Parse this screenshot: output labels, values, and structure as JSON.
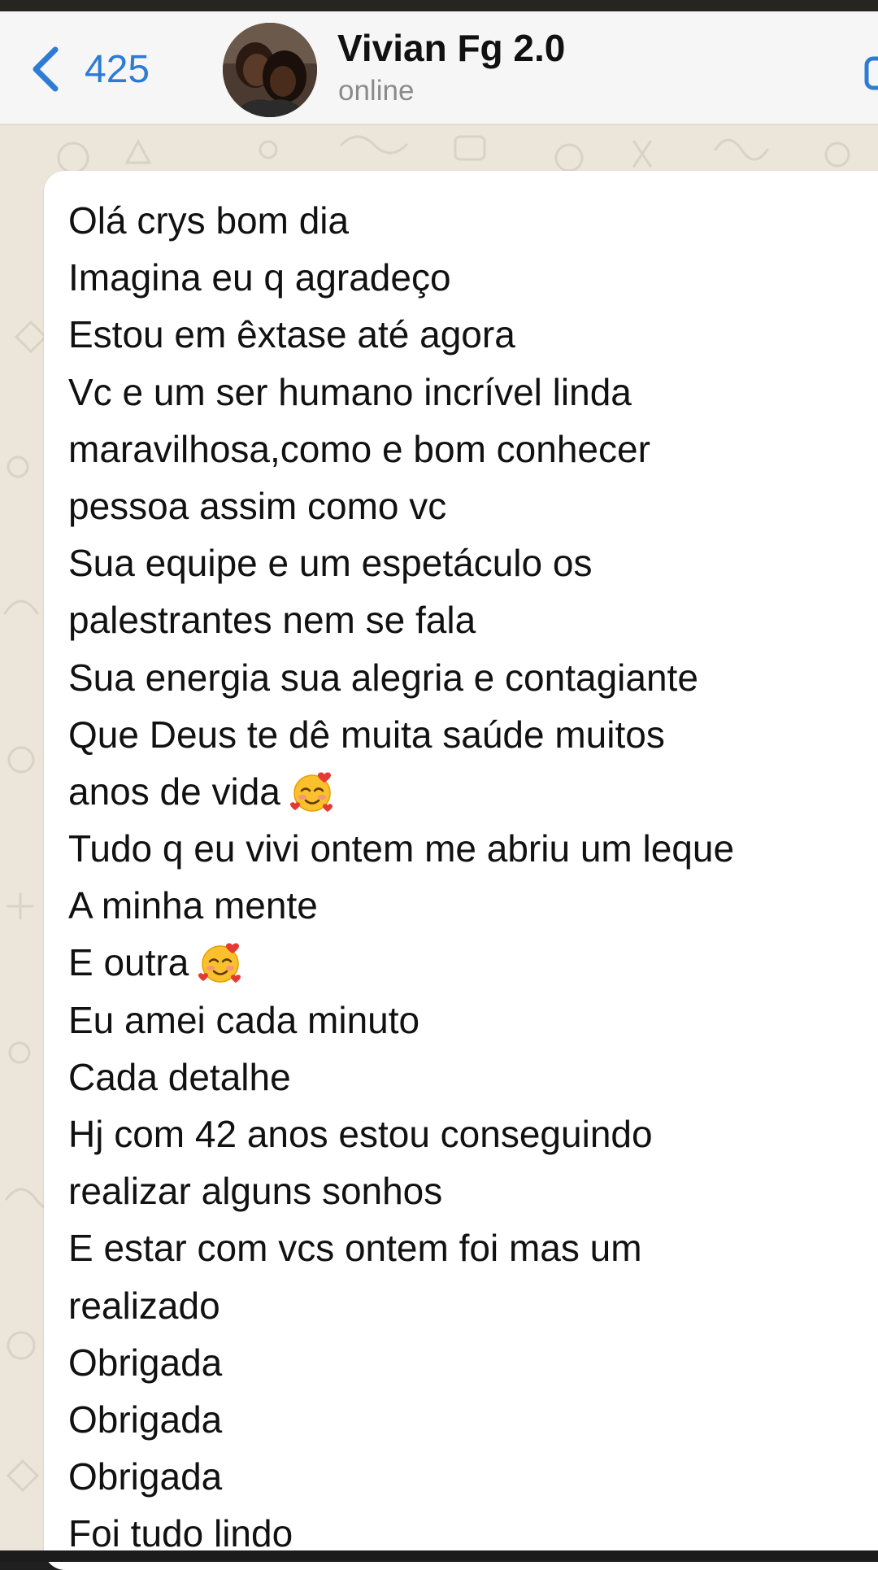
{
  "header": {
    "back_count": "425",
    "contact_name": "Vivian Fg 2.0",
    "contact_status": "online"
  },
  "message": {
    "lines": [
      {
        "text": "Olá crys bom dia"
      },
      {
        "text": "Imagina eu q agradeço"
      },
      {
        "text": "Estou em êxtase até agora"
      },
      {
        "text": "Vc e um ser humano incrível linda"
      },
      {
        "text": "maravilhosa,como e bom conhecer"
      },
      {
        "text": "pessoa assim como vc"
      },
      {
        "text": "Sua equipe e um espetáculo os"
      },
      {
        "text": "palestrantes nem se fala"
      },
      {
        "text": "Sua energia sua alegria e contagiante"
      },
      {
        "text": "Que Deus te dê muita saúde muitos"
      },
      {
        "text": "anos de vida",
        "emoji": "smiling-face-with-hearts-icon"
      },
      {
        "text": "Tudo q eu vivi ontem me abriu um leque"
      },
      {
        "text": "A minha mente"
      },
      {
        "text": "E outra",
        "emoji": "smiling-face-with-hearts-icon"
      },
      {
        "text": "Eu amei cada minuto"
      },
      {
        "text": "Cada detalhe"
      },
      {
        "text": "Hj com 42 anos estou conseguindo"
      },
      {
        "text": "realizar alguns sonhos"
      },
      {
        "text": "E estar com vcs ontem foi mas um"
      },
      {
        "text": "realizado"
      },
      {
        "text": "Obrigada"
      },
      {
        "text": "Obrigada"
      },
      {
        "text": "Obrigada"
      },
      {
        "text": "Foi tudo lindo"
      }
    ]
  },
  "colors": {
    "accent": "#2e7bd6",
    "header_bg": "#f6f6f6",
    "chat_bg": "#ebe5da",
    "bubble_bg": "#ffffff",
    "status_text": "#8b8b8b"
  },
  "icons": [
    "chevron-left-icon",
    "video-call-icon",
    "smiling-face-with-hearts-icon"
  ]
}
